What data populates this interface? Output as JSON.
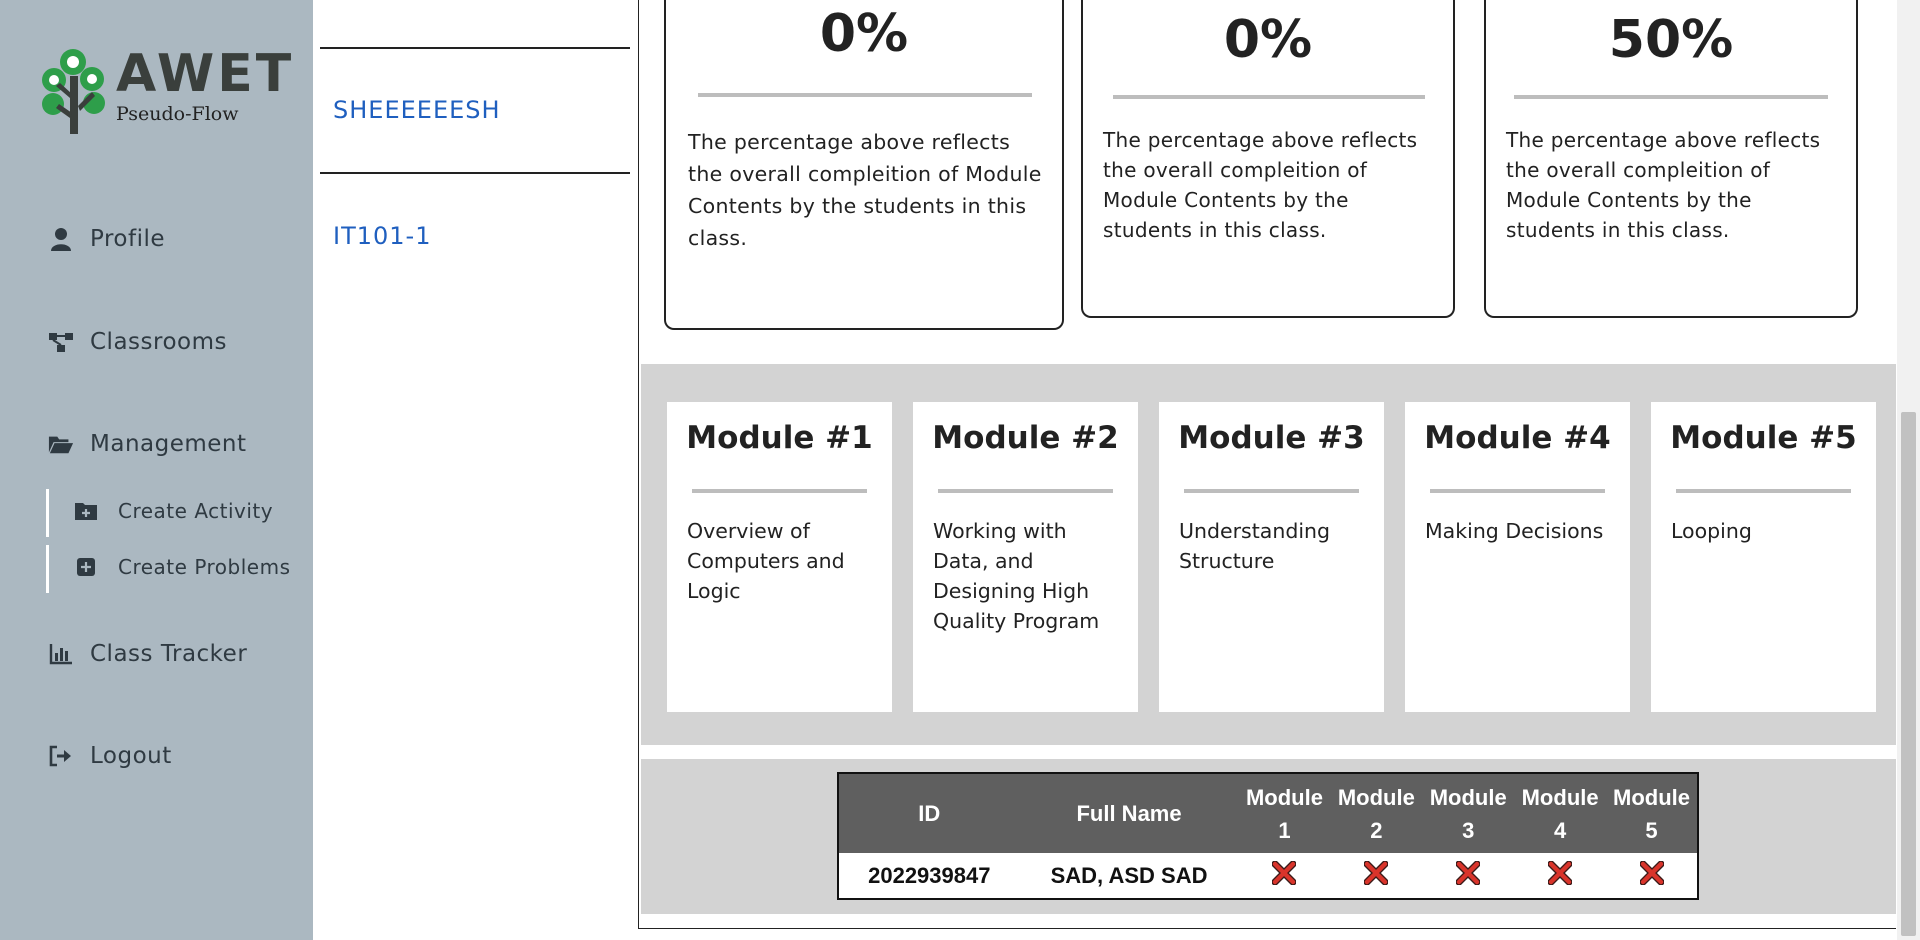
{
  "app": {
    "brand": "AWET",
    "subtitle": "Pseudo-Flow"
  },
  "sidebar": {
    "items": [
      {
        "label": "Profile",
        "icon": "user-icon"
      },
      {
        "label": "Classrooms",
        "icon": "network-icon"
      },
      {
        "label": "Management",
        "icon": "folder-open-icon"
      },
      {
        "label": "Class Tracker",
        "icon": "bar-chart-icon"
      },
      {
        "label": "Logout",
        "icon": "logout-icon"
      }
    ],
    "sub_items": [
      {
        "label": "Create Activity",
        "icon": "add-folder-icon"
      },
      {
        "label": "Create Problems",
        "icon": "plus-square-icon"
      }
    ]
  },
  "classes": [
    {
      "label": "SHEEEEEESH"
    },
    {
      "label": "IT101-1"
    }
  ],
  "completion_cards": [
    {
      "percent": "0%",
      "description": "The percentage above reflects the overall compleition of Module Contents by the students in this class."
    },
    {
      "percent": "0%",
      "description": "The percentage above reflects the overall compleition of Module Contents by the students in this class."
    },
    {
      "percent": "50%",
      "description": "The percentage above reflects the overall compleition of Module Contents by the students in this class."
    }
  ],
  "modules": [
    {
      "title": "Module #1",
      "description": "Overview of Computers and Logic"
    },
    {
      "title": "Module #2",
      "description": "Working with Data, and Designing High Quality Program"
    },
    {
      "title": "Module #3",
      "description": "Understanding Structure"
    },
    {
      "title": "Module #4",
      "description": "Making Decisions"
    },
    {
      "title": "Module #5",
      "description": "Looping"
    }
  ],
  "tracker": {
    "headers": {
      "id": "ID",
      "name": "Full Name",
      "modules": [
        {
          "line1": "Module",
          "line2": "1"
        },
        {
          "line1": "Module",
          "line2": "2"
        },
        {
          "line1": "Module",
          "line2": "3"
        },
        {
          "line1": "Module",
          "line2": "4"
        },
        {
          "line1": "Module",
          "line2": "5"
        }
      ]
    },
    "rows": [
      {
        "id": "2022939847",
        "name": "SAD, ASD SAD",
        "status": [
          "incomplete",
          "incomplete",
          "incomplete",
          "incomplete",
          "incomplete"
        ]
      }
    ]
  },
  "colors": {
    "sidebar_bg": "#abb8c1",
    "link": "#1f5fbf",
    "band_bg": "#d3d3d3",
    "table_header": "#5f5f5f",
    "x_mark": "#d9342b",
    "logo_green": "#2e9e4a"
  }
}
